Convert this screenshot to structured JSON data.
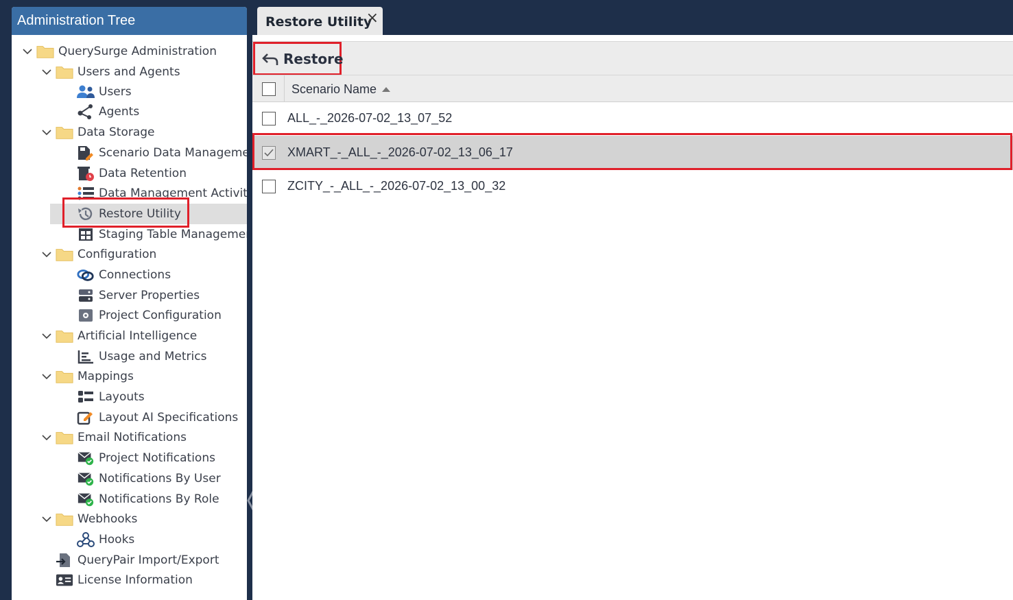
{
  "left_panel": {
    "title": "Administration Tree",
    "tree": [
      {
        "label": "QuerySurge Administration",
        "icon": "folder-icon"
      },
      {
        "label": "Users and Agents",
        "icon": "folder-icon"
      },
      {
        "label": "Users",
        "icon": "users-icon"
      },
      {
        "label": "Agents",
        "icon": "agents-icon"
      },
      {
        "label": "Data Storage",
        "icon": "folder-icon"
      },
      {
        "label": "Scenario Data Management",
        "icon": "scenario-data-icon"
      },
      {
        "label": "Data Retention",
        "icon": "data-retention-icon"
      },
      {
        "label": "Data Management Activity",
        "icon": "activity-list-icon"
      },
      {
        "label": "Restore Utility",
        "icon": "history-icon"
      },
      {
        "label": "Staging Table Management",
        "icon": "table-icon"
      },
      {
        "label": "Configuration",
        "icon": "folder-icon"
      },
      {
        "label": "Connections",
        "icon": "link-icon"
      },
      {
        "label": "Server Properties",
        "icon": "server-icon"
      },
      {
        "label": "Project Configuration",
        "icon": "project-config-icon"
      },
      {
        "label": "Artificial Intelligence",
        "icon": "folder-icon"
      },
      {
        "label": "Usage and Metrics",
        "icon": "chart-icon"
      },
      {
        "label": "Mappings",
        "icon": "folder-icon"
      },
      {
        "label": "Layouts",
        "icon": "layouts-icon"
      },
      {
        "label": "Layout AI Specifications",
        "icon": "edit-icon"
      },
      {
        "label": "Email Notifications",
        "icon": "folder-icon"
      },
      {
        "label": "Project Notifications",
        "icon": "mail-check-icon"
      },
      {
        "label": "Notifications By User",
        "icon": "mail-check-icon"
      },
      {
        "label": "Notifications By Role",
        "icon": "mail-check-icon"
      },
      {
        "label": "Webhooks",
        "icon": "folder-icon"
      },
      {
        "label": "Hooks",
        "icon": "webhook-icon"
      },
      {
        "label": "QueryPair Import/Export",
        "icon": "file-import-icon"
      },
      {
        "label": "License Information",
        "icon": "license-icon"
      }
    ],
    "selected": "Restore Utility"
  },
  "tab": {
    "label": "Restore Utility",
    "close": "×"
  },
  "toolbar": {
    "restore_label": "Restore"
  },
  "grid": {
    "column_header": "Scenario Name",
    "rows": [
      {
        "name": "ALL_-_2026-07-02_13_07_52",
        "checked": false
      },
      {
        "name": "XMART_-_ALL_-_2026-07-02_13_06_17",
        "checked": true
      },
      {
        "name": "ZCITY_-_ALL_-_2026-07-02_13_00_32",
        "checked": false
      }
    ]
  },
  "colors": {
    "navy_background": "#1e2f4a",
    "header_blue": "#3a6ea5",
    "highlight_red": "#e0202a",
    "selected_row": "#d3d3d3",
    "folder_yellow": "#f6d886"
  }
}
